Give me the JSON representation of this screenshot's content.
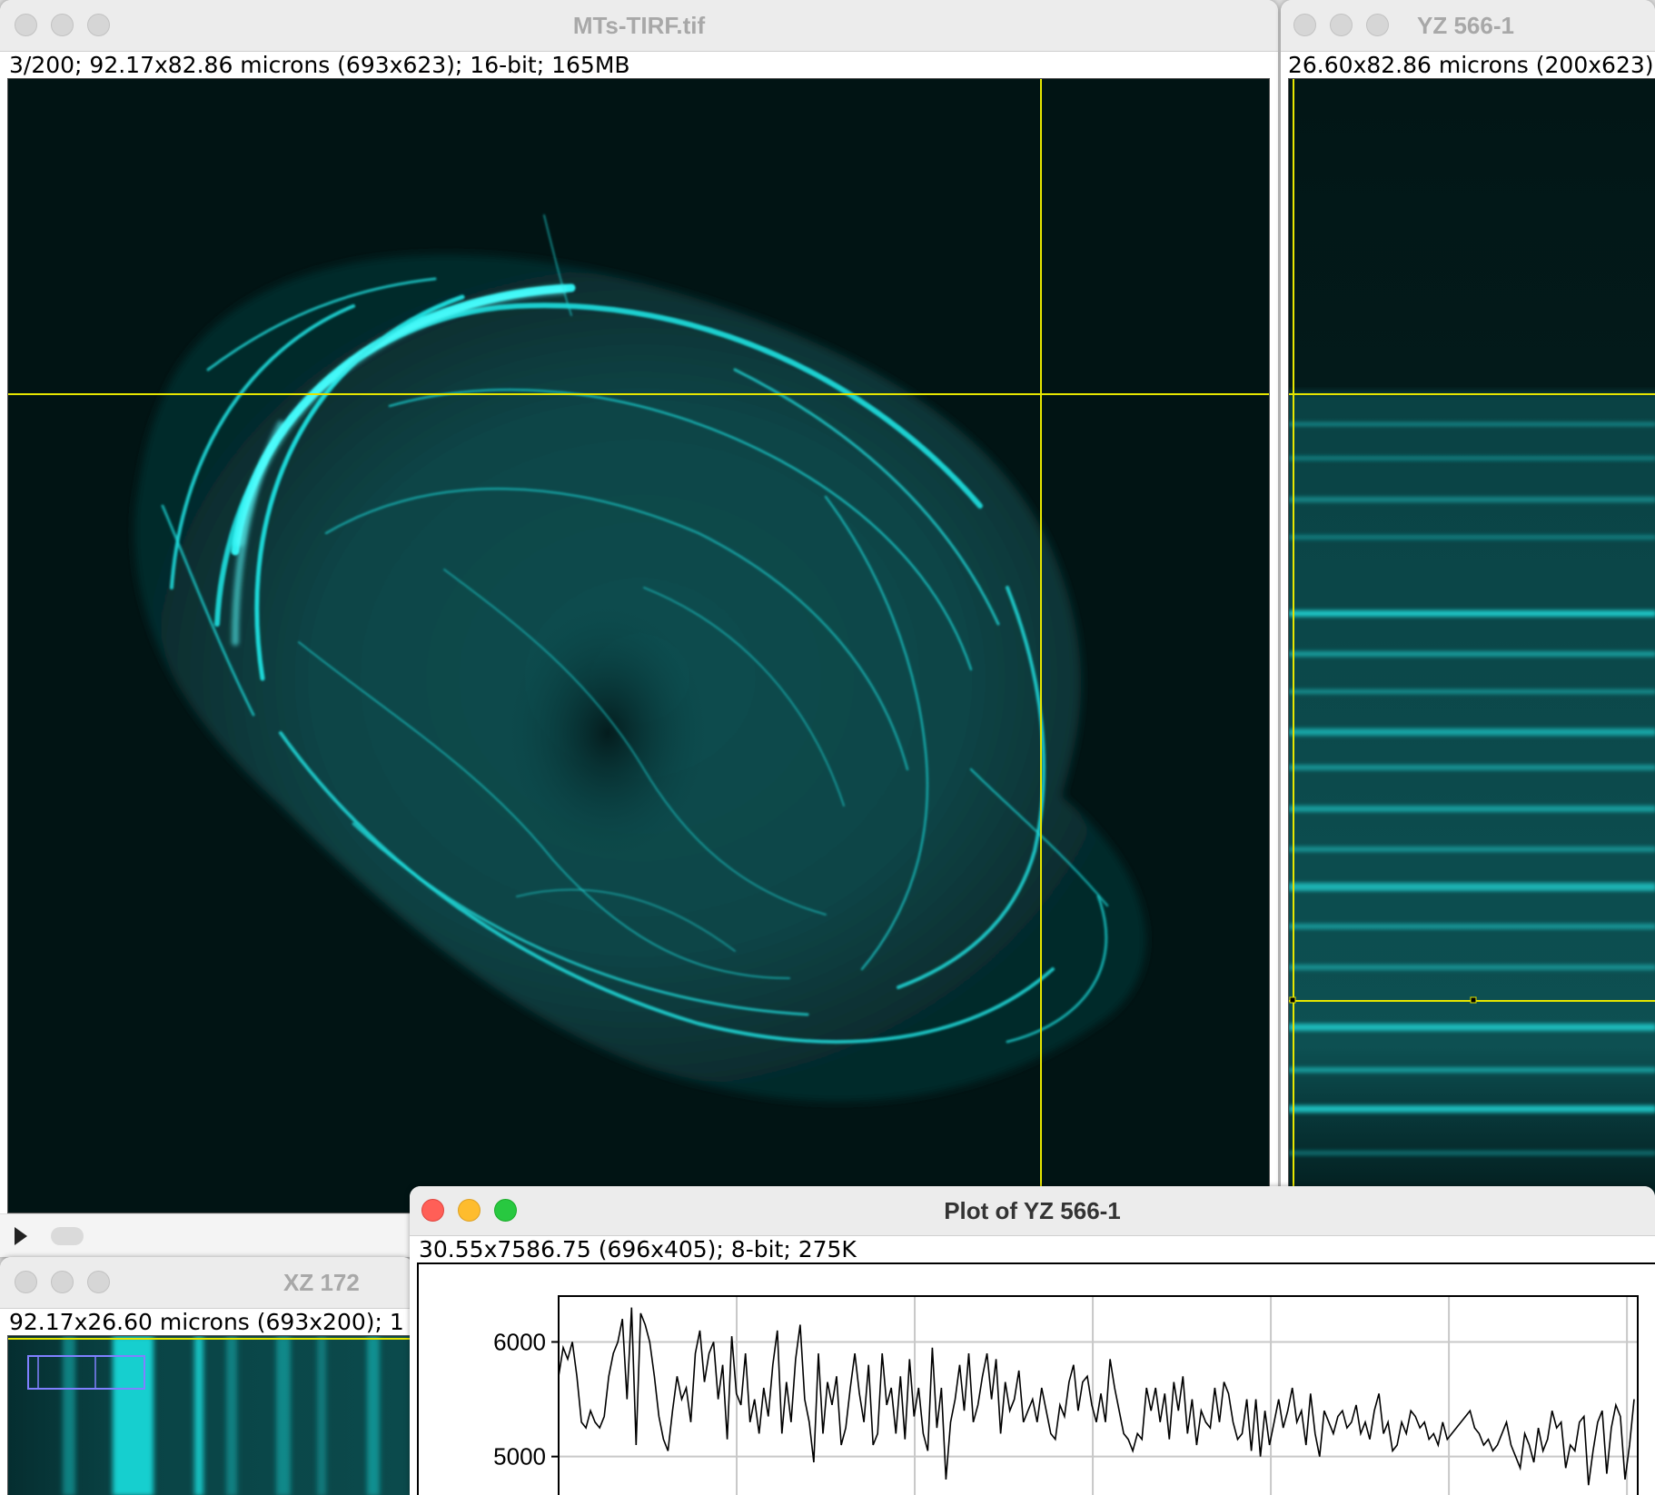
{
  "main_window": {
    "title": "MTs-TIRF.tif",
    "info": "3/200; 92.17x82.86 microns (693x623); 16-bit; 165MB"
  },
  "yz_window": {
    "title": "YZ 566-1",
    "info": "26.60x82.86 microns (200x623)"
  },
  "xz_window": {
    "title": "XZ 172",
    "info": "92.17x26.60 microns (693x200); 1"
  },
  "plot_window": {
    "title": "Plot of YZ 566-1",
    "info": "30.55x7586.75   (696x405); 8-bit; 275K"
  },
  "colors": {
    "cyan": "#14e6e6",
    "crosshair": "#e6e600",
    "traffic_red": "#ff5f57",
    "traffic_yellow": "#febc2e",
    "traffic_green": "#28c840"
  },
  "icons": {
    "play": "play-icon",
    "close": "close-icon",
    "minimize": "minimize-icon",
    "zoom": "zoom-icon"
  },
  "chart_data": {
    "type": "line",
    "title": "",
    "xlabel": "",
    "ylabel": "",
    "yticks": [
      5000,
      6000
    ],
    "ytick_labels": [
      "6000",
      "5000"
    ],
    "ylim": [
      4300,
      6400
    ],
    "xlim": [
      0,
      30.55
    ],
    "grid": true,
    "series": [
      {
        "values": [
          5700,
          5950,
          5850,
          6000,
          5700,
          5300,
          5250,
          5400,
          5300,
          5250,
          5350,
          5700,
          5900,
          6000,
          6200,
          5500,
          6300,
          5100,
          6250,
          6150,
          6000,
          5700,
          5350,
          5150,
          5050,
          5400,
          5700,
          5500,
          5600,
          5300,
          5900,
          6100,
          5650,
          5900,
          6000,
          5500,
          5800,
          5150,
          6050,
          5550,
          5450,
          5900,
          5300,
          5500,
          5200,
          5600,
          5350,
          5800,
          6100,
          5200,
          5650,
          5300,
          5850,
          6150,
          5500,
          5300,
          4950,
          5900,
          5200,
          5650,
          5450,
          5700,
          5100,
          5250,
          5600,
          5900,
          5550,
          5300,
          5800,
          5100,
          5200,
          5900,
          5450,
          5600,
          5200,
          5700,
          5150,
          5850,
          5350,
          5600,
          5200,
          5050,
          5950,
          5250,
          5600,
          4800,
          5300,
          5500,
          5800,
          5400,
          5900,
          5300,
          5450,
          5700,
          5900,
          5500,
          5850,
          5200,
          5650,
          5400,
          5500,
          5750,
          5300,
          5400,
          5500,
          5300,
          5600,
          5400,
          5200,
          5150,
          5450,
          5350,
          5650,
          5800,
          5400,
          5650,
          5700,
          5450,
          5300,
          5550,
          5300,
          5850,
          5600,
          5400,
          5200,
          5150,
          5050,
          5200,
          5150,
          5600,
          5400,
          5600,
          5300,
          5550,
          5150,
          5650,
          5400,
          5700,
          5200,
          5500,
          5100,
          5400,
          5300,
          5250,
          5600,
          5300,
          5650,
          5550,
          5300,
          5150,
          5200,
          5500,
          5050,
          5500,
          5000,
          5400,
          5100,
          5300,
          5500,
          5250,
          5400,
          5600,
          5300,
          5400,
          5100,
          5550,
          5200,
          5000,
          5400,
          5300,
          5200,
          5350,
          5400,
          5250,
          5300,
          5450,
          5200,
          5300,
          5150,
          5400,
          5550,
          5200,
          5300,
          5050,
          5100,
          5300,
          5200,
          5400,
          5350,
          5250,
          5300,
          5150,
          5200,
          5100,
          5300,
          5150,
          5200,
          5250,
          5300,
          5350,
          5400,
          5250,
          5200,
          5100,
          5150,
          5050,
          5100,
          5200,
          5300,
          5100,
          5000,
          4900,
          5200,
          5100,
          4950,
          5250,
          5050,
          5150,
          5400,
          5250,
          5300,
          4900,
          5100,
          5050,
          5300,
          5350,
          4750,
          5050,
          5300,
          5400,
          4850,
          5250,
          5450,
          5350,
          4800,
          5100,
          5500
        ]
      }
    ]
  }
}
